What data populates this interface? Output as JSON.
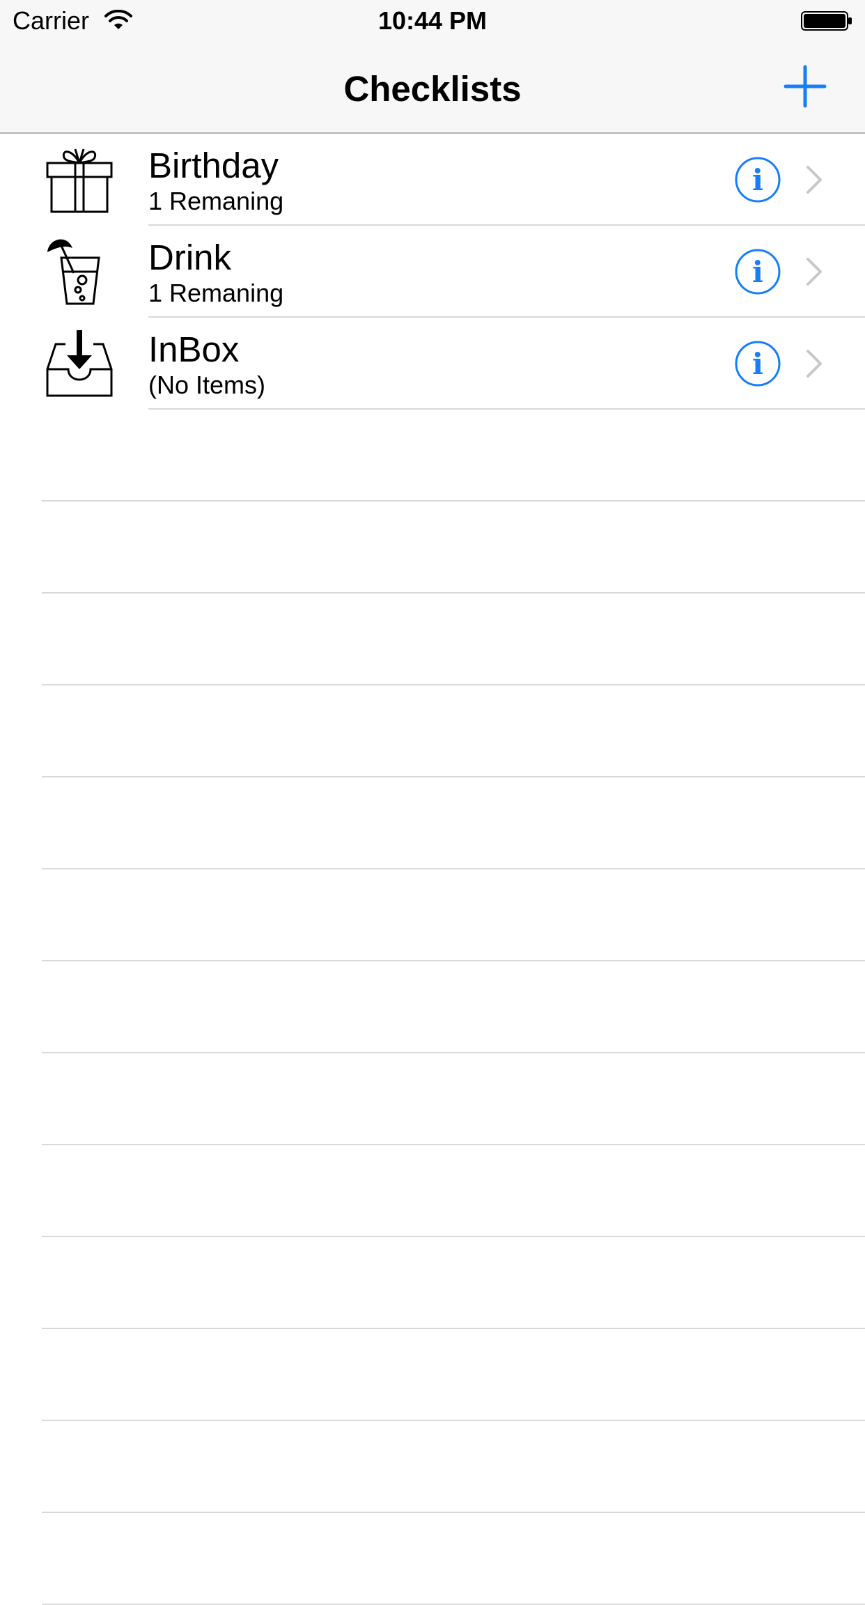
{
  "status_bar": {
    "carrier": "Carrier",
    "time": "10:44 PM",
    "wifi_icon": "wifi-icon",
    "battery_icon": "battery-full-icon"
  },
  "nav": {
    "title": "Checklists",
    "add_icon": "plus-icon"
  },
  "colors": {
    "accent": "#147efb",
    "separator": "#d9d9d9",
    "chevron": "#c7c7cc",
    "bar_background": "#f7f7f7"
  },
  "checklists": [
    {
      "title": "Birthday",
      "subtitle": "1 Remaning",
      "icon": "gift-icon"
    },
    {
      "title": "Drink",
      "subtitle": "1 Remaning",
      "icon": "drink-icon"
    },
    {
      "title": "InBox",
      "subtitle": "(No Items)",
      "icon": "inbox-icon"
    }
  ],
  "row_accessories": {
    "info_icon": "info-icon",
    "disclosure_icon": "chevron-right-icon"
  }
}
